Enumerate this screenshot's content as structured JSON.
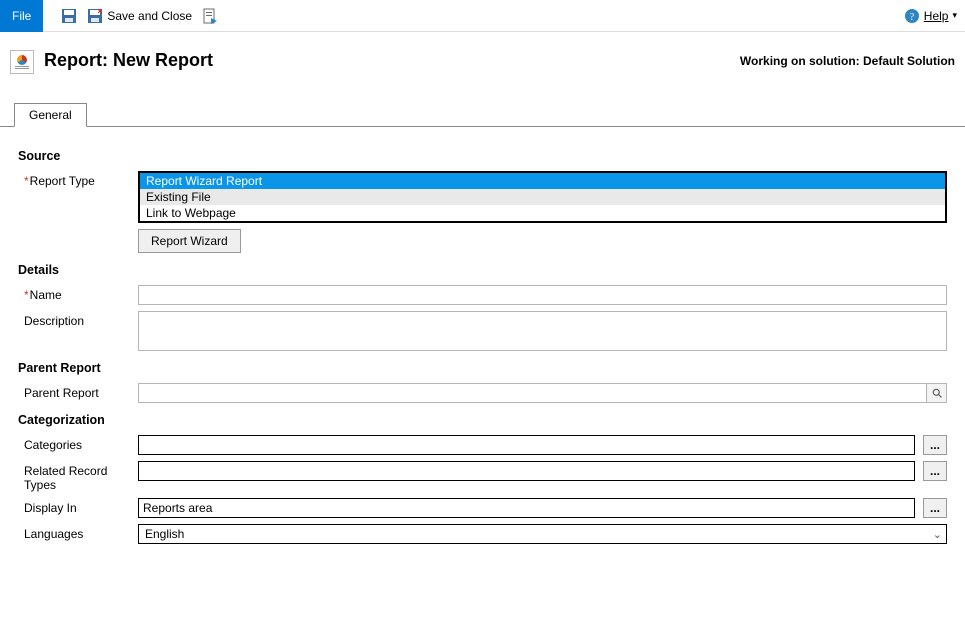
{
  "toolbar": {
    "file_label": "File",
    "save_and_close_label": "Save and Close",
    "help_label": "Help"
  },
  "header": {
    "title": "Report: New Report",
    "solution_text": "Working on solution: Default Solution"
  },
  "tabs": {
    "general": "General"
  },
  "source": {
    "section_label": "Source",
    "report_type_label": "Report Type",
    "options": [
      "Report Wizard Report",
      "Existing File",
      "Link to Webpage"
    ],
    "wizard_button": "Report Wizard"
  },
  "details": {
    "section_label": "Details",
    "name_label": "Name",
    "name_value": "",
    "description_label": "Description",
    "description_value": ""
  },
  "parent": {
    "section_label": "Parent Report",
    "label": "Parent Report",
    "value": ""
  },
  "categorization": {
    "section_label": "Categorization",
    "categories_label": "Categories",
    "categories_value": "",
    "related_label": "Related Record Types",
    "related_value": "",
    "display_in_label": "Display In",
    "display_in_value": "Reports area",
    "languages_label": "Languages",
    "languages_value": "English"
  },
  "glyphs": {
    "ellipsis": "..."
  }
}
